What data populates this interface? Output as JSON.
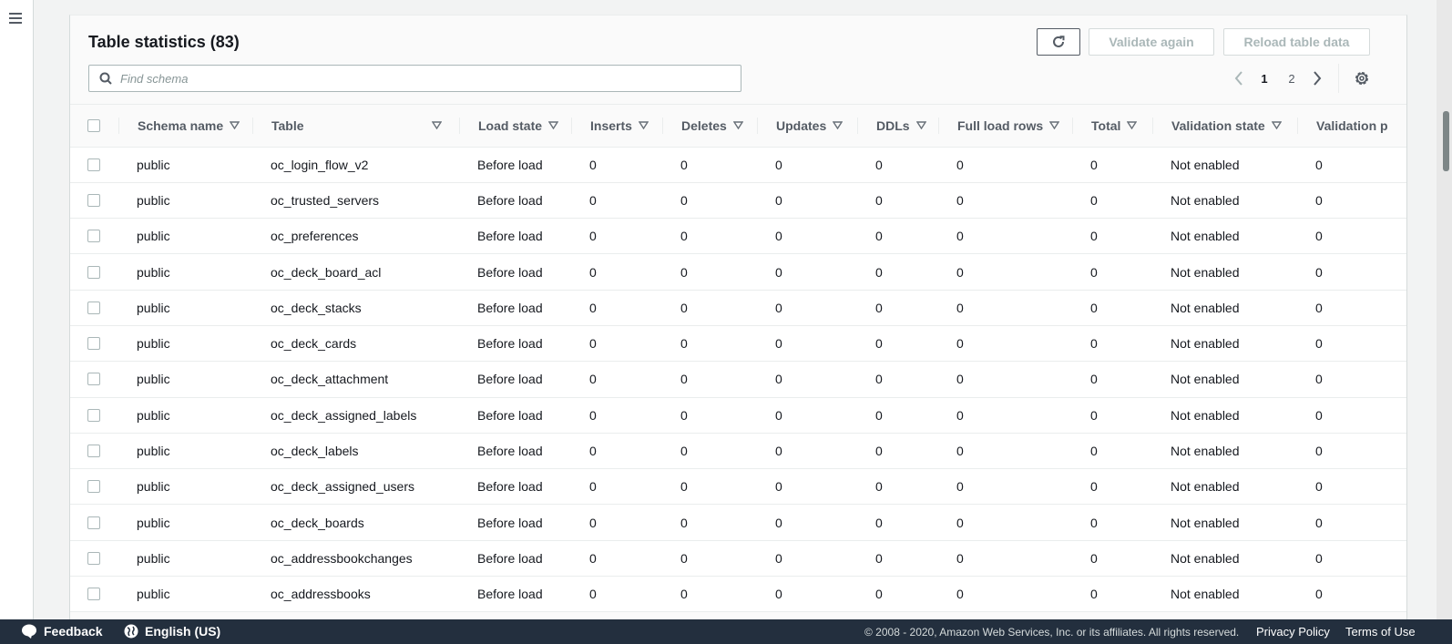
{
  "nav": {
    "menu_icon": "hamburger-icon"
  },
  "header": {
    "title": "Table statistics (83)",
    "refresh_icon": "refresh-icon",
    "validate_again_label": "Validate again",
    "reload_table_data_label": "Reload table data"
  },
  "search": {
    "placeholder": "Find schema",
    "value": ""
  },
  "pagination": {
    "current_page": "1",
    "pages": [
      "1",
      "2"
    ],
    "prev_icon": "chevron-left-icon",
    "next_icon": "chevron-right-icon",
    "settings_icon": "gear-icon"
  },
  "table": {
    "columns": [
      "Schema name",
      "Table",
      "Load state",
      "Inserts",
      "Deletes",
      "Updates",
      "DDLs",
      "Full load rows",
      "Total",
      "Validation state",
      "Validation p"
    ],
    "rows": [
      [
        "public",
        "oc_login_flow_v2",
        "Before load",
        "0",
        "0",
        "0",
        "0",
        "0",
        "0",
        "Not enabled",
        "0"
      ],
      [
        "public",
        "oc_trusted_servers",
        "Before load",
        "0",
        "0",
        "0",
        "0",
        "0",
        "0",
        "Not enabled",
        "0"
      ],
      [
        "public",
        "oc_preferences",
        "Before load",
        "0",
        "0",
        "0",
        "0",
        "0",
        "0",
        "Not enabled",
        "0"
      ],
      [
        "public",
        "oc_deck_board_acl",
        "Before load",
        "0",
        "0",
        "0",
        "0",
        "0",
        "0",
        "Not enabled",
        "0"
      ],
      [
        "public",
        "oc_deck_stacks",
        "Before load",
        "0",
        "0",
        "0",
        "0",
        "0",
        "0",
        "Not enabled",
        "0"
      ],
      [
        "public",
        "oc_deck_cards",
        "Before load",
        "0",
        "0",
        "0",
        "0",
        "0",
        "0",
        "Not enabled",
        "0"
      ],
      [
        "public",
        "oc_deck_attachment",
        "Before load",
        "0",
        "0",
        "0",
        "0",
        "0",
        "0",
        "Not enabled",
        "0"
      ],
      [
        "public",
        "oc_deck_assigned_labels",
        "Before load",
        "0",
        "0",
        "0",
        "0",
        "0",
        "0",
        "Not enabled",
        "0"
      ],
      [
        "public",
        "oc_deck_labels",
        "Before load",
        "0",
        "0",
        "0",
        "0",
        "0",
        "0",
        "Not enabled",
        "0"
      ],
      [
        "public",
        "oc_deck_assigned_users",
        "Before load",
        "0",
        "0",
        "0",
        "0",
        "0",
        "0",
        "Not enabled",
        "0"
      ],
      [
        "public",
        "oc_deck_boards",
        "Before load",
        "0",
        "0",
        "0",
        "0",
        "0",
        "0",
        "Not enabled",
        "0"
      ],
      [
        "public",
        "oc_addressbookchanges",
        "Before load",
        "0",
        "0",
        "0",
        "0",
        "0",
        "0",
        "Not enabled",
        "0"
      ],
      [
        "public",
        "oc_addressbooks",
        "Before load",
        "0",
        "0",
        "0",
        "0",
        "0",
        "0",
        "Not enabled",
        "0"
      ]
    ]
  },
  "footer": {
    "feedback_label": "Feedback",
    "language_label": "English (US)",
    "copyright": "© 2008 - 2020, Amazon Web Services, Inc. or its affiliates. All rights reserved.",
    "privacy_label": "Privacy Policy",
    "terms_label": "Terms of Use"
  },
  "colors": {
    "footer_bg": "#232f3e",
    "text": "#16191f",
    "muted": "#545b64",
    "disabled": "#aab7b8"
  }
}
